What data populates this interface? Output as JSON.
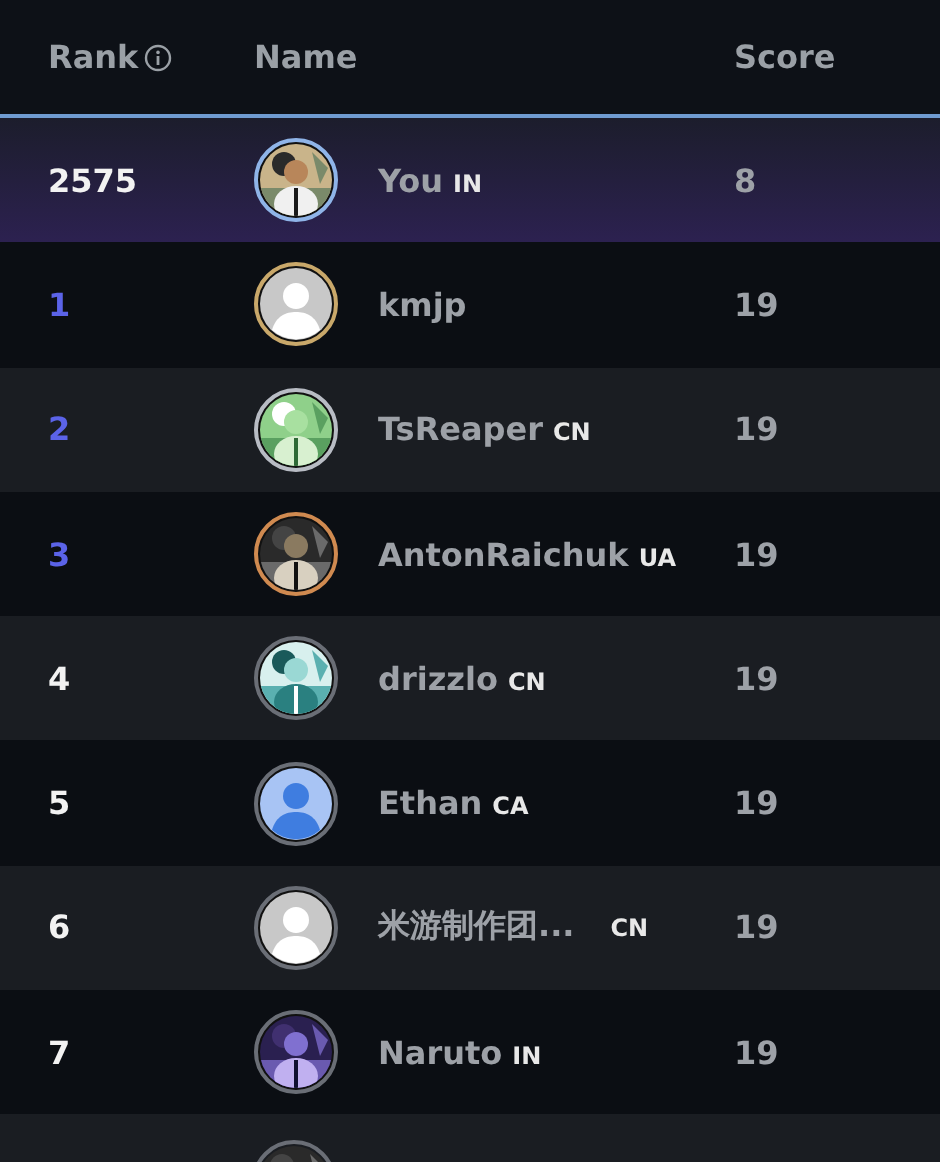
{
  "header": {
    "columns": [
      "Rank",
      "Name",
      "Score"
    ]
  },
  "rows": [
    {
      "rank": "2575",
      "name": "You",
      "country": "IN",
      "score": "8",
      "current": true,
      "top": false,
      "color": "#8fb4e8"
    },
    {
      "rank": "1",
      "name": "kmjp",
      "score": "19",
      "current": false,
      "top": true,
      "kind": "default",
      "color": "#c9a86a"
    },
    {
      "rank": "2",
      "name": "TsReaper",
      "country": "CN",
      "score": "19",
      "current": false,
      "top": true,
      "color": "#b8bcc4"
    },
    {
      "rank": "3",
      "name": "AntonRaichuk",
      "country": "UA",
      "score": "19",
      "current": false,
      "top": true,
      "color": "#d08a50"
    },
    {
      "rank": "4",
      "name": "drizzlo",
      "country": "CN",
      "score": "19",
      "current": false,
      "top": false,
      "color": "#6a6e76"
    },
    {
      "rank": "5",
      "name": "Ethan",
      "country": "CA",
      "score": "19",
      "current": false,
      "top": false,
      "kind": "generic",
      "color": "#6a6e76"
    },
    {
      "rank": "6",
      "name": "米游制作团...",
      "country": "CN",
      "score": "19",
      "current": false,
      "top": false,
      "kind": "default",
      "color": "#6a6e76"
    },
    {
      "rank": "7",
      "name": "Naruto",
      "country": "IN",
      "score": "19",
      "current": false,
      "top": false,
      "color": "#6a6e76"
    }
  ]
}
